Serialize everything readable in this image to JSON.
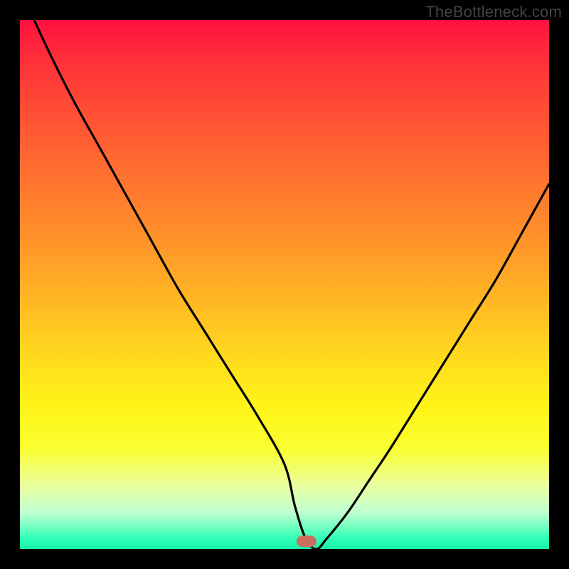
{
  "watermark": "TheBottleneck.com",
  "marker": {
    "color": "#cc6e5e",
    "x_fraction": 0.541,
    "y_fraction": 0.985
  },
  "chart_data": {
    "type": "line",
    "title": "",
    "xlabel": "",
    "ylabel": "",
    "xlim": [
      0,
      100
    ],
    "ylim": [
      0,
      100
    ],
    "x": [
      0,
      5,
      10,
      15,
      20,
      25,
      30,
      35,
      40,
      45,
      50,
      52,
      54,
      56,
      58,
      62,
      66,
      70,
      75,
      80,
      85,
      90,
      95,
      100
    ],
    "values": [
      106,
      95,
      85,
      76,
      67,
      58,
      49,
      41,
      33,
      25,
      16,
      8,
      2,
      0,
      2,
      7,
      13,
      19,
      27,
      35,
      43,
      51,
      60,
      69
    ],
    "notes": "V-shaped bottleneck curve; y = mismatch percentage (0 at optimum ≈ x 54–56); background gradient encodes severity red→green."
  }
}
